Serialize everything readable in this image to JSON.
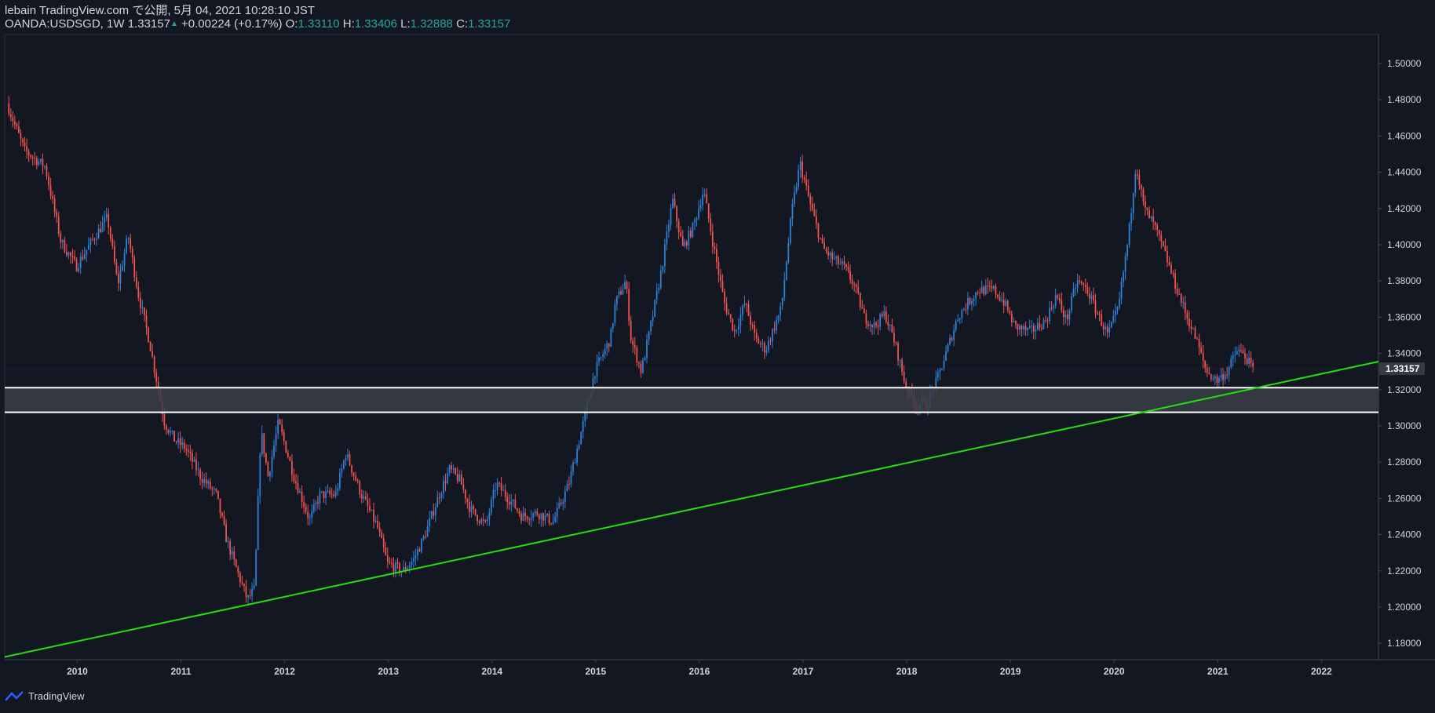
{
  "header": {
    "publish_line": "lebain TradingView.com で公開, 5月 04, 2021 10:28:10 JST",
    "symbol": "OANDA:USDSGD, 1W",
    "last": "1.33157",
    "change_arrow": "▲",
    "change": "+0.00224 (+0.17%)",
    "o_label": "O:",
    "o_value": "1.33110",
    "h_label": "H:",
    "h_value": "1.33406",
    "l_label": "L:",
    "l_value": "1.32888",
    "c_label": "C:",
    "c_value": "1.33157"
  },
  "footer": {
    "brand": "TradingView",
    "logo_icon": "tradingview-logo-icon"
  },
  "colors": {
    "background": "#131722",
    "up": "#2f7fd6",
    "down": "#ef5350",
    "trendline": "#22e00f",
    "zone_border": "#ffffff",
    "zone_fill": "#3a3e47",
    "axis_text": "#d1d4dc",
    "price_tag_bg": "#363a45"
  },
  "chart_data": {
    "type": "candlestick",
    "symbol": "OANDA:USDSGD",
    "interval": "1W",
    "x_range": [
      2009.3,
      2022.55
    ],
    "y_range": [
      1.171,
      1.516
    ],
    "x_ticks": [
      "2010",
      "2011",
      "2012",
      "2013",
      "2014",
      "2015",
      "2016",
      "2017",
      "2018",
      "2019",
      "2020",
      "2021",
      "2022"
    ],
    "y_ticks": [
      "1.18000",
      "1.20000",
      "1.22000",
      "1.24000",
      "1.26000",
      "1.28000",
      "1.30000",
      "1.32000",
      "1.34000",
      "1.36000",
      "1.38000",
      "1.40000",
      "1.42000",
      "1.44000",
      "1.46000",
      "1.48000",
      "1.50000"
    ],
    "last_price_label": "1.33157",
    "last_price": 1.33157,
    "support_zone": [
      1.3075,
      1.3211
    ],
    "trendline": {
      "from": [
        2009.3,
        1.1725
      ],
      "to": [
        2022.55,
        1.3355
      ]
    },
    "path_points": [
      [
        2009.33,
        1.478
      ],
      [
        2009.5,
        1.452
      ],
      [
        2009.7,
        1.443
      ],
      [
        2009.85,
        1.402
      ],
      [
        2010.0,
        1.388
      ],
      [
        2010.15,
        1.402
      ],
      [
        2010.3,
        1.415
      ],
      [
        2010.4,
        1.378
      ],
      [
        2010.5,
        1.405
      ],
      [
        2010.6,
        1.372
      ],
      [
        2010.7,
        1.348
      ],
      [
        2010.85,
        1.302
      ],
      [
        2010.95,
        1.292
      ],
      [
        2011.05,
        1.288
      ],
      [
        2011.2,
        1.272
      ],
      [
        2011.35,
        1.262
      ],
      [
        2011.45,
        1.237
      ],
      [
        2011.55,
        1.22
      ],
      [
        2011.65,
        1.204
      ],
      [
        2011.72,
        1.21
      ],
      [
        2011.78,
        1.298
      ],
      [
        2011.85,
        1.272
      ],
      [
        2011.95,
        1.302
      ],
      [
        2012.1,
        1.272
      ],
      [
        2012.25,
        1.248
      ],
      [
        2012.35,
        1.262
      ],
      [
        2012.5,
        1.262
      ],
      [
        2012.6,
        1.285
      ],
      [
        2012.75,
        1.262
      ],
      [
        2012.9,
        1.245
      ],
      [
        2013.0,
        1.224
      ],
      [
        2013.15,
        1.22
      ],
      [
        2013.25,
        1.226
      ],
      [
        2013.35,
        1.238
      ],
      [
        2013.5,
        1.262
      ],
      [
        2013.6,
        1.276
      ],
      [
        2013.7,
        1.27
      ],
      [
        2013.8,
        1.254
      ],
      [
        2013.95,
        1.245
      ],
      [
        2014.05,
        1.268
      ],
      [
        2014.2,
        1.258
      ],
      [
        2014.3,
        1.25
      ],
      [
        2014.45,
        1.252
      ],
      [
        2014.6,
        1.247
      ],
      [
        2014.75,
        1.268
      ],
      [
        2014.9,
        1.304
      ],
      [
        2015.0,
        1.33
      ],
      [
        2015.15,
        1.348
      ],
      [
        2015.2,
        1.368
      ],
      [
        2015.3,
        1.38
      ],
      [
        2015.35,
        1.348
      ],
      [
        2015.45,
        1.33
      ],
      [
        2015.55,
        1.358
      ],
      [
        2015.65,
        1.388
      ],
      [
        2015.75,
        1.425
      ],
      [
        2015.85,
        1.398
      ],
      [
        2015.95,
        1.41
      ],
      [
        2016.05,
        1.43
      ],
      [
        2016.15,
        1.398
      ],
      [
        2016.25,
        1.368
      ],
      [
        2016.35,
        1.352
      ],
      [
        2016.45,
        1.368
      ],
      [
        2016.55,
        1.348
      ],
      [
        2016.65,
        1.342
      ],
      [
        2016.8,
        1.365
      ],
      [
        2016.9,
        1.418
      ],
      [
        2016.98,
        1.445
      ],
      [
        2017.08,
        1.422
      ],
      [
        2017.2,
        1.398
      ],
      [
        2017.3,
        1.392
      ],
      [
        2017.4,
        1.388
      ],
      [
        2017.5,
        1.378
      ],
      [
        2017.6,
        1.36
      ],
      [
        2017.7,
        1.355
      ],
      [
        2017.8,
        1.362
      ],
      [
        2017.9,
        1.345
      ],
      [
        2018.0,
        1.322
      ],
      [
        2018.1,
        1.312
      ],
      [
        2018.2,
        1.312
      ],
      [
        2018.3,
        1.325
      ],
      [
        2018.4,
        1.342
      ],
      [
        2018.5,
        1.36
      ],
      [
        2018.6,
        1.368
      ],
      [
        2018.7,
        1.375
      ],
      [
        2018.85,
        1.375
      ],
      [
        2018.95,
        1.368
      ],
      [
        2019.05,
        1.355
      ],
      [
        2019.2,
        1.352
      ],
      [
        2019.35,
        1.358
      ],
      [
        2019.45,
        1.372
      ],
      [
        2019.55,
        1.358
      ],
      [
        2019.65,
        1.38
      ],
      [
        2019.75,
        1.375
      ],
      [
        2019.85,
        1.362
      ],
      [
        2019.95,
        1.35
      ],
      [
        2020.05,
        1.365
      ],
      [
        2020.15,
        1.405
      ],
      [
        2020.22,
        1.445
      ],
      [
        2020.3,
        1.42
      ],
      [
        2020.4,
        1.41
      ],
      [
        2020.5,
        1.395
      ],
      [
        2020.6,
        1.378
      ],
      [
        2020.7,
        1.362
      ],
      [
        2020.8,
        1.348
      ],
      [
        2020.9,
        1.33
      ],
      [
        2021.0,
        1.325
      ],
      [
        2021.1,
        1.33
      ],
      [
        2021.2,
        1.342
      ],
      [
        2021.28,
        1.338
      ],
      [
        2021.34,
        1.3316
      ]
    ]
  }
}
